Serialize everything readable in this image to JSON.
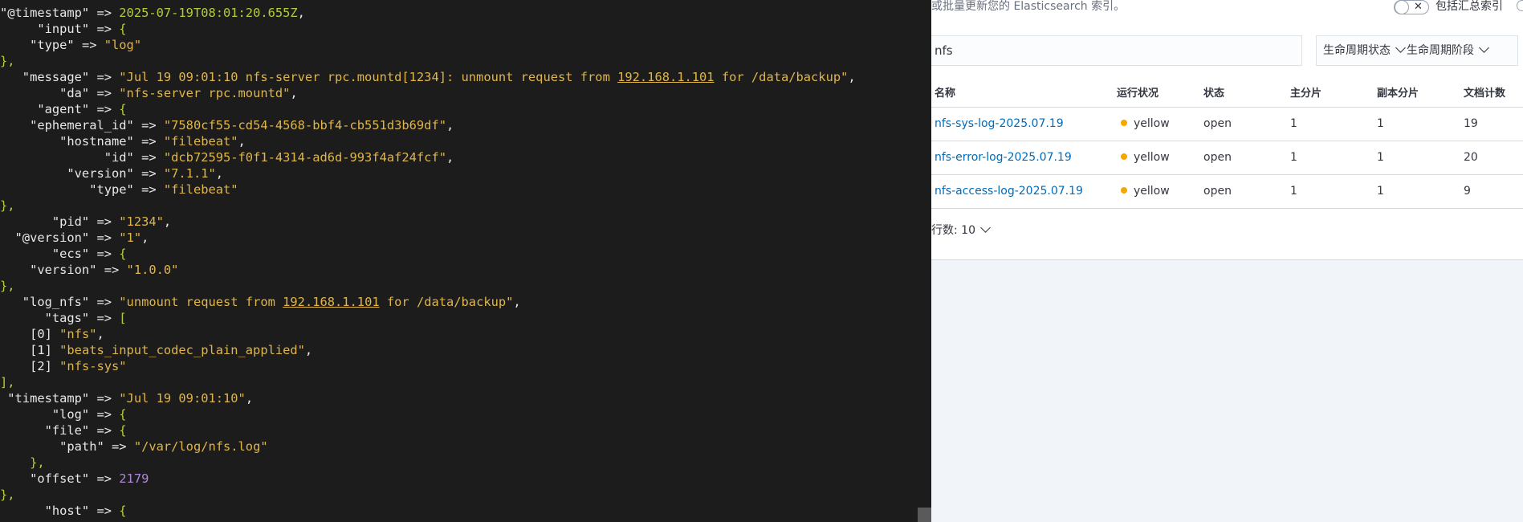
{
  "terminal": {
    "lines": [
      [
        [
          "k",
          "\"@timestamp\""
        ],
        [
          "p",
          " => "
        ],
        [
          "ts",
          "2025-07-19T08:01:20.655Z"
        ],
        [
          "p",
          ","
        ]
      ],
      [
        [
          "k",
          "     \"input\""
        ],
        [
          "p",
          " => "
        ],
        [
          "b",
          "{"
        ]
      ],
      [
        [
          "k",
          "    \"type\""
        ],
        [
          "p",
          " => "
        ],
        [
          "s",
          "\"log\""
        ]
      ],
      [
        [
          "b",
          "},"
        ]
      ],
      [
        [
          "k",
          "   \"message\""
        ],
        [
          "p",
          " => "
        ],
        [
          "s",
          "\"Jul 19 09:01:10 nfs-server rpc.mountd[1234]: unmount request from "
        ],
        [
          "su",
          "192.168.1.101"
        ],
        [
          "s",
          " for /data/backup\""
        ],
        [
          "p",
          ","
        ]
      ],
      [
        [
          "k",
          "        \"da\""
        ],
        [
          "p",
          " => "
        ],
        [
          "s",
          "\"nfs-server rpc.mountd\""
        ],
        [
          "p",
          ","
        ]
      ],
      [
        [
          "k",
          "     \"agent\""
        ],
        [
          "p",
          " => "
        ],
        [
          "b",
          "{"
        ]
      ],
      [
        [
          "k",
          "    \"ephemeral_id\""
        ],
        [
          "p",
          " => "
        ],
        [
          "s",
          "\"7580cf55-cd54-4568-bbf4-cb551d3b69df\""
        ],
        [
          "p",
          ","
        ]
      ],
      [
        [
          "k",
          "        \"hostname\""
        ],
        [
          "p",
          " => "
        ],
        [
          "s",
          "\"filebeat\""
        ],
        [
          "p",
          ","
        ]
      ],
      [
        [
          "k",
          "              \"id\""
        ],
        [
          "p",
          " => "
        ],
        [
          "s",
          "\"dcb72595-f0f1-4314-ad6d-993f4af24fcf\""
        ],
        [
          "p",
          ","
        ]
      ],
      [
        [
          "k",
          "         \"version\""
        ],
        [
          "p",
          " => "
        ],
        [
          "s",
          "\"7.1.1\""
        ],
        [
          "p",
          ","
        ]
      ],
      [
        [
          "k",
          "            \"type\""
        ],
        [
          "p",
          " => "
        ],
        [
          "s",
          "\"filebeat\""
        ]
      ],
      [
        [
          "b",
          "},"
        ]
      ],
      [
        [
          "k",
          "       \"pid\""
        ],
        [
          "p",
          " => "
        ],
        [
          "s",
          "\"1234\""
        ],
        [
          "p",
          ","
        ]
      ],
      [
        [
          "k",
          "  \"@version\""
        ],
        [
          "p",
          " => "
        ],
        [
          "s",
          "\"1\""
        ],
        [
          "p",
          ","
        ]
      ],
      [
        [
          "k",
          "       \"ecs\""
        ],
        [
          "p",
          " => "
        ],
        [
          "b",
          "{"
        ]
      ],
      [
        [
          "k",
          "    \"version\""
        ],
        [
          "p",
          " => "
        ],
        [
          "s",
          "\"1.0.0\""
        ]
      ],
      [
        [
          "b",
          "},"
        ]
      ],
      [
        [
          "k",
          "   \"log_nfs\""
        ],
        [
          "p",
          " => "
        ],
        [
          "s",
          "\"unmount request from "
        ],
        [
          "su",
          "192.168.1.101"
        ],
        [
          "s",
          " for /data/backup\""
        ],
        [
          "p",
          ","
        ]
      ],
      [
        [
          "k",
          "      \"tags\""
        ],
        [
          "p",
          " => "
        ],
        [
          "b",
          "["
        ]
      ],
      [
        [
          "p",
          "    [0] "
        ],
        [
          "s",
          "\"nfs\""
        ],
        [
          "p",
          ","
        ]
      ],
      [
        [
          "p",
          "    [1] "
        ],
        [
          "s",
          "\"beats_input_codec_plain_applied\""
        ],
        [
          "p",
          ","
        ]
      ],
      [
        [
          "p",
          "    [2] "
        ],
        [
          "s",
          "\"nfs-sys\""
        ]
      ],
      [
        [
          "b",
          "],"
        ]
      ],
      [
        [
          "k",
          " \"timestamp\""
        ],
        [
          "p",
          " => "
        ],
        [
          "s",
          "\"Jul 19 09:01:10\""
        ],
        [
          "p",
          ","
        ]
      ],
      [
        [
          "k",
          "       \"log\""
        ],
        [
          "p",
          " => "
        ],
        [
          "b",
          "{"
        ]
      ],
      [
        [
          "k",
          "      \"file\""
        ],
        [
          "p",
          " => "
        ],
        [
          "b",
          "{"
        ]
      ],
      [
        [
          "k",
          "        \"path\""
        ],
        [
          "p",
          " => "
        ],
        [
          "s",
          "\"/var/log/nfs.log\""
        ]
      ],
      [
        [
          "b",
          "    },"
        ]
      ],
      [
        [
          "k",
          "    \"offset\""
        ],
        [
          "p",
          " => "
        ],
        [
          "n",
          "2179"
        ]
      ],
      [
        [
          "b",
          "},"
        ]
      ],
      [
        [
          "k",
          "      \"host\""
        ],
        [
          "p",
          " => "
        ],
        [
          "b",
          "{"
        ]
      ]
    ]
  },
  "panel": {
    "description": "或批量更新您的 Elasticsearch 索引。",
    "toggle_x": "✕",
    "toggle_label": "包括汇总索引",
    "search_value": "nfs",
    "filters": [
      {
        "label": "生命周期状态"
      },
      {
        "label": "生命周期阶段"
      }
    ],
    "columns": [
      "名称",
      "运行状况",
      "状态",
      "主分片",
      "副本分片",
      "文档计数"
    ],
    "rows": [
      {
        "name": "nfs-sys-log-2025.07.19",
        "health": "yellow",
        "status": "open",
        "primary": "1",
        "replica": "1",
        "docs": "19"
      },
      {
        "name": "nfs-error-log-2025.07.19",
        "health": "yellow",
        "status": "open",
        "primary": "1",
        "replica": "1",
        "docs": "20"
      },
      {
        "name": "nfs-access-log-2025.07.19",
        "health": "yellow",
        "status": "open",
        "primary": "1",
        "replica": "1",
        "docs": "9"
      }
    ],
    "rows_per_page": "行数: 10"
  },
  "colors": {
    "terminal_bg": "#1c1c1c",
    "string": "#e0b64a",
    "timestamp": "#b5cc3a",
    "number": "#b08ad8",
    "link": "#006bb8",
    "health_yellow": "#f5a700"
  }
}
